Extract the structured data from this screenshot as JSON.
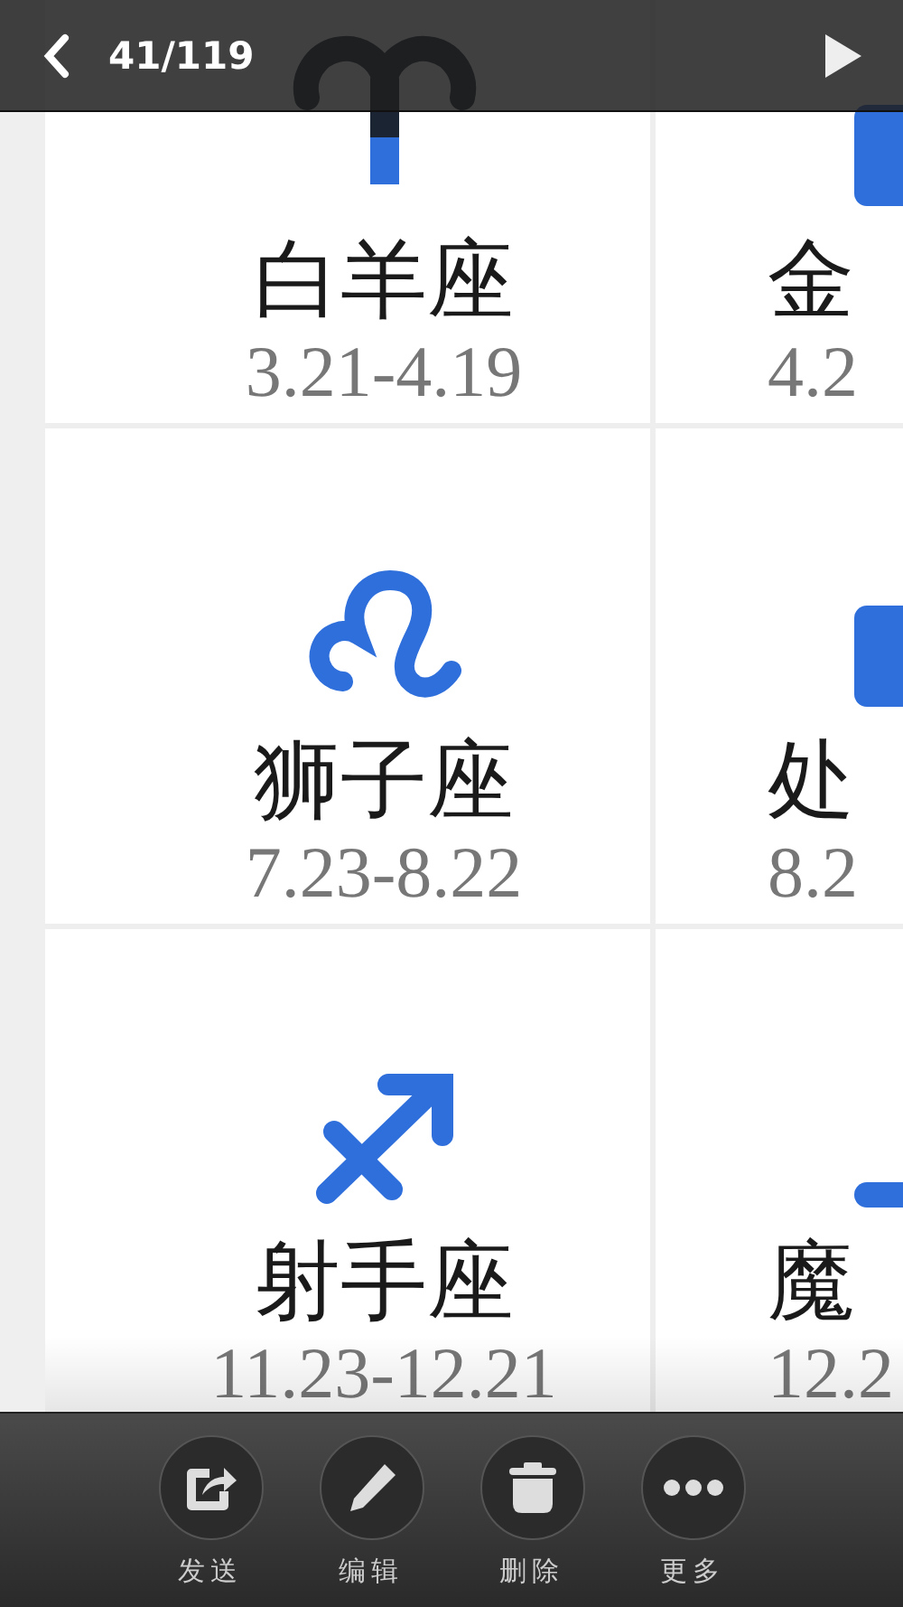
{
  "top_bar": {
    "counter": "41/119"
  },
  "signs": [
    {
      "kind": "aries",
      "name": "白羊座",
      "dates": "3.21-4.19"
    },
    {
      "kind": "taurus",
      "name": "金",
      "dates": "4.2"
    },
    {
      "kind": "leo",
      "name": "狮子座",
      "dates": "7.23-8.22"
    },
    {
      "kind": "virgo",
      "name": "处",
      "dates": "8.2"
    },
    {
      "kind": "sagittarius",
      "name": "射手座",
      "dates": "11.23-12.21"
    },
    {
      "kind": "capricorn",
      "name": "魔",
      "dates": "12.2"
    }
  ],
  "toolbar": [
    {
      "kind": "send",
      "label": "发送"
    },
    {
      "kind": "edit",
      "label": "编辑"
    },
    {
      "kind": "delete",
      "label": "删除"
    },
    {
      "kind": "more",
      "label": "更多"
    }
  ]
}
